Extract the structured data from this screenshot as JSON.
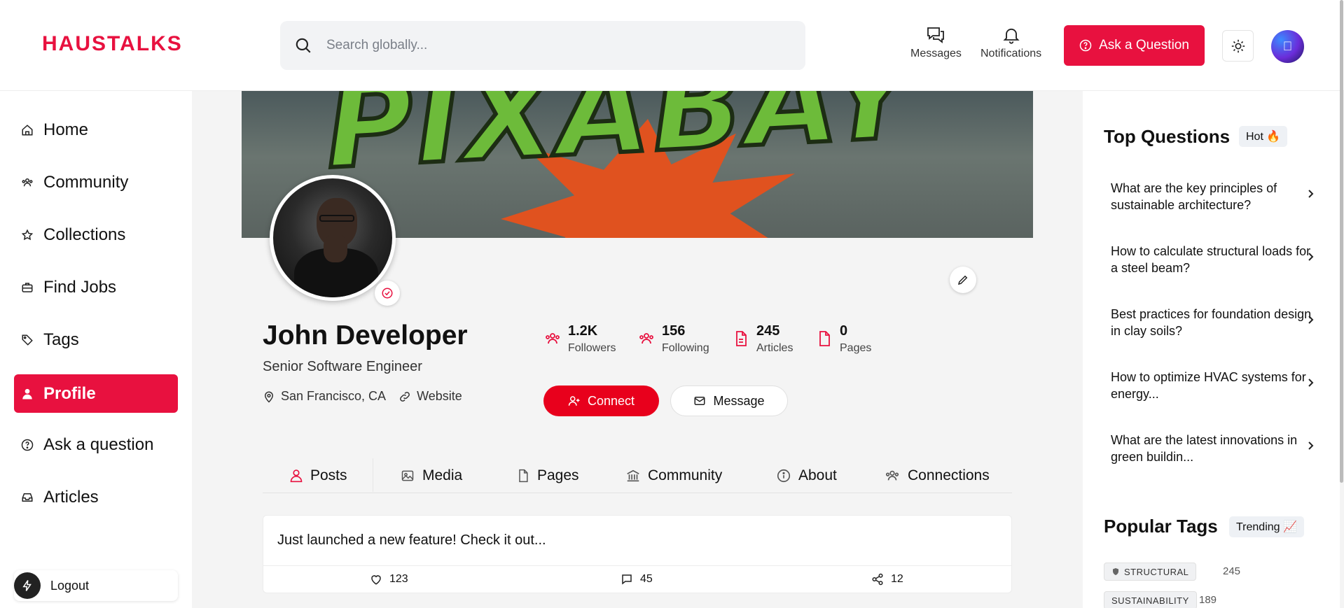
{
  "header": {
    "logo": "HAUSTALKS",
    "search_placeholder": "Search globally...",
    "messages_label": "Messages",
    "notifications_label": "Notifications",
    "ask_label": "Ask a Question"
  },
  "sidebar": {
    "items": [
      {
        "label": "Home",
        "icon": "home-icon"
      },
      {
        "label": "Community",
        "icon": "community-icon"
      },
      {
        "label": "Collections",
        "icon": "star-icon"
      },
      {
        "label": "Find Jobs",
        "icon": "briefcase-icon"
      },
      {
        "label": "Tags",
        "icon": "tag-icon"
      },
      {
        "label": "Profile",
        "icon": "user-icon",
        "active": true
      },
      {
        "label": "Ask a question",
        "icon": "question-icon"
      },
      {
        "label": "Articles",
        "icon": "inbox-icon"
      }
    ],
    "logout_label": "Logout"
  },
  "cover": {
    "watermark": "PIXABAY"
  },
  "profile": {
    "name": "John Developer",
    "title": "Senior Software Engineer",
    "location": "San Francisco, CA",
    "website": "Website",
    "stats": [
      {
        "value": "1.2K",
        "label": "Followers"
      },
      {
        "value": "156",
        "label": "Following"
      },
      {
        "value": "245",
        "label": "Articles"
      },
      {
        "value": "0",
        "label": "Pages"
      }
    ],
    "connect_label": "Connect",
    "message_label": "Message"
  },
  "tabs": [
    "Posts",
    "Media",
    "Pages",
    "Community",
    "About",
    "Connections"
  ],
  "post": {
    "text": "Just launched a new feature! Check it out...",
    "likes": "123",
    "comments": "45",
    "shares": "12"
  },
  "right": {
    "top_questions_title": "Top Questions",
    "hot_badge": "Hot 🔥",
    "questions": [
      "What are the key principles of sustainable architecture?",
      "How to calculate structural loads for a steel beam?",
      "Best practices for foundation design in clay soils?",
      "How to optimize HVAC systems for energy...",
      "What are the latest innovations in green buildin..."
    ],
    "popular_tags_title": "Popular Tags",
    "trending_badge": "Trending 📈",
    "tags": [
      {
        "name": "STRUCTURAL",
        "count": "245"
      },
      {
        "name": "SUSTAINABILITY",
        "count": "189"
      }
    ]
  },
  "colors": {
    "accent": "#e8113f",
    "connect": "#e8001c"
  }
}
